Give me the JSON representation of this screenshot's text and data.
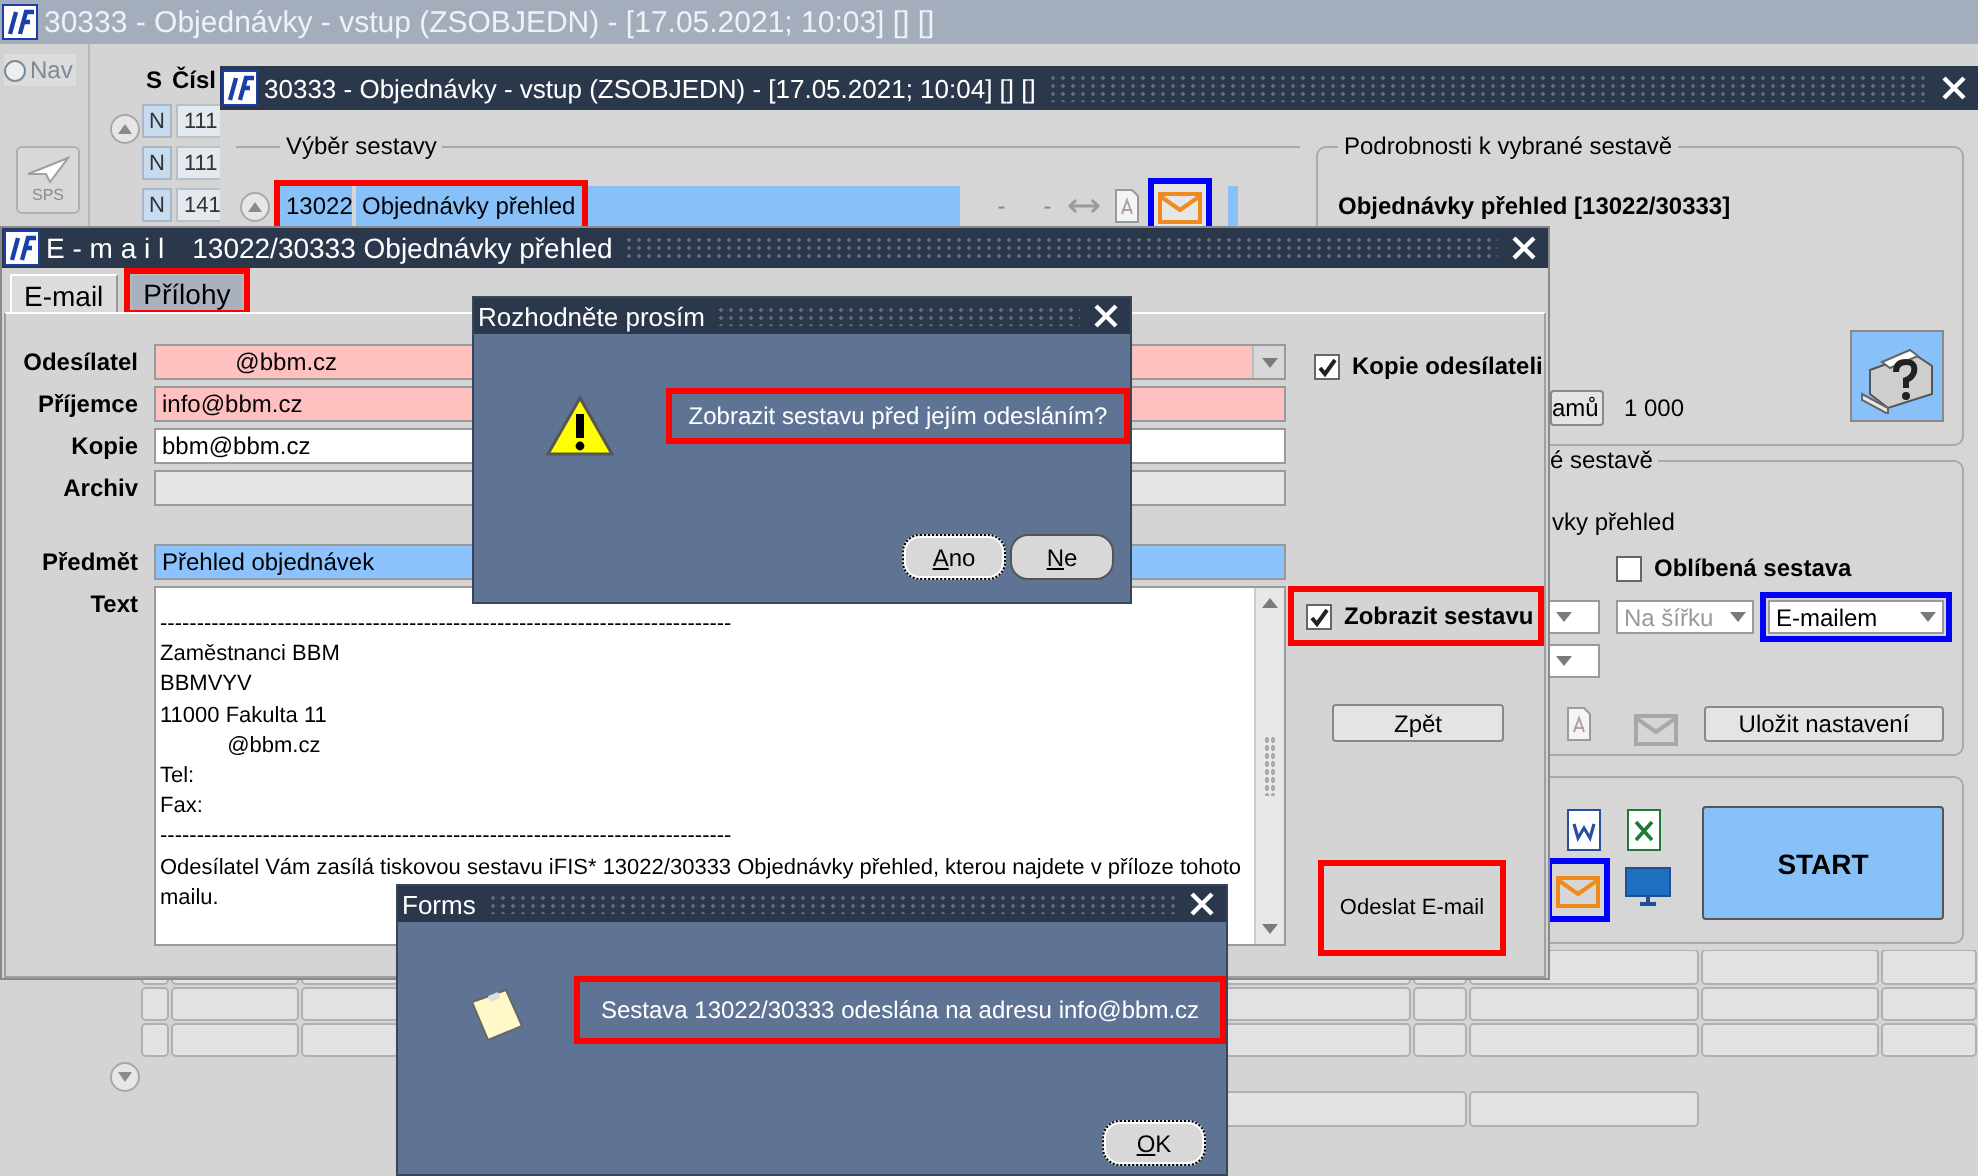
{
  "background_window": {
    "title": "30333 - Objednávky - vstup (ZSOBJEDN) - [17.05.2021; 10:03] [] []",
    "nav": {
      "label": "Nav",
      "selected": false
    },
    "sps_button": "SPS",
    "columns": [
      "S",
      "Čísl"
    ],
    "rows": [
      {
        "s": "N",
        "number": "111"
      },
      {
        "s": "N",
        "number": "111"
      },
      {
        "s": "N",
        "number": "141"
      }
    ]
  },
  "report_window": {
    "title": "30333 - Objednávky - vstup (ZSOBJEDN) - [17.05.2021; 10:04] [] []",
    "report_selection": {
      "label": "Výběr sestavy",
      "rows": [
        {
          "code": "13022",
          "name": "Objednávky přehled",
          "selected": true,
          "frame": {
            "color": "#ff0000"
          },
          "column_3": "-",
          "column_4": "-",
          "mail_frame": {
            "color": "#0000ff"
          }
        }
      ]
    },
    "details": {
      "label": "Podrobnosti k vybrané sestavě",
      "title": "Objednávky přehled [13022/30333]",
      "button": "amů",
      "count": "1 000"
    },
    "settings": {
      "label": "é sestavě",
      "name": "vky přehled",
      "favorite": {
        "label": "Oblíbená sestava",
        "checked": false
      },
      "selects": [
        {
          "value": "Na šířku",
          "disabled": true
        },
        {
          "value": "E-mailem",
          "disabled": false,
          "frame": {
            "color": "#0000ff"
          }
        }
      ],
      "save_button": "Uložit nastavení"
    },
    "output": {
      "mail_frame": {
        "color": "#0000ff"
      },
      "start_button": "START"
    }
  },
  "email_window": {
    "title_prefix": "E - m a i l",
    "title": "13022/30333 Objednávky přehled",
    "tabs": [
      {
        "label": "E-mail",
        "selected": true
      },
      {
        "label": "Přílohy",
        "selected": false,
        "frame": {
          "color": "#ff0000"
        }
      }
    ],
    "fields": [
      {
        "label": "Odesílatel",
        "value": "           @bbm.cz",
        "kind": "dropdown",
        "required": true,
        "disabled": false,
        "focused": false
      },
      {
        "label": "Příjemce",
        "value": "info@bbm.cz",
        "kind": "text",
        "required": true,
        "disabled": false,
        "focused": false
      },
      {
        "label": "Kopie",
        "value": "bbm@bbm.cz",
        "kind": "text",
        "required": false,
        "disabled": false,
        "focused": false
      },
      {
        "label": "Archiv",
        "kind": "text",
        "required": false,
        "disabled": true,
        "focused": false
      },
      {
        "label": "Předmět",
        "value": "Přehled objednávek",
        "kind": "text",
        "required": false,
        "disabled": false,
        "focused": true
      }
    ],
    "text": {
      "label": "Text",
      "lines": [
        "------------------------------------------------------------------------------",
        "Zaměstnanci BBM",
        "BBMVYV",
        "11000 Fakulta 11",
        "           @bbm.cz",
        "Tel:",
        "Fax:",
        "------------------------------------------------------------------------------",
        "Odesílatel Vám zasílá tiskovou sestavu iFIS* 13022/30333 Objednávky přehled, kterou najdete v příloze tohoto",
        "mailu."
      ]
    },
    "checkboxes": [
      {
        "label": "Kopie odesílateli",
        "checked": true
      },
      {
        "label": "Zobrazit sestavu",
        "checked": true,
        "frame": {
          "color": "#ff0000"
        }
      }
    ],
    "buttons": [
      {
        "label": "Zpět"
      },
      {
        "label": "Odeslat E-mail",
        "frame": {
          "color": "#ff0000"
        }
      }
    ]
  },
  "confirm_dialog": {
    "title": "Rozhodněte prosím",
    "message": "Zobrazit sestavu před jejím odesláním?",
    "frame": {
      "color": "#ff0000"
    },
    "buttons": [
      {
        "label": "Ano",
        "focused": true
      },
      {
        "label": "Ne",
        "focused": false
      }
    ]
  },
  "info_dialog": {
    "title": "Forms",
    "message": "Sestava 13022/30333 odeslána na adresu info@bbm.cz",
    "frame": {
      "color": "#ff0000"
    },
    "buttons": [
      {
        "label": "OK",
        "focused": true
      }
    ]
  }
}
